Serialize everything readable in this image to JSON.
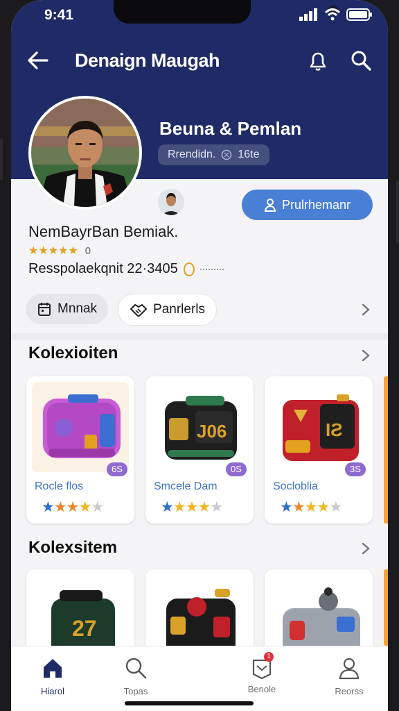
{
  "status_bar": {
    "time": "9:41"
  },
  "header": {
    "title": "Denaign Maugah"
  },
  "profile": {
    "hero_name": "Beuna & Pemlan",
    "hero_tag": "Rrendidn.",
    "hero_tag_count": "16te",
    "follow_label": "Prulrhemanr",
    "name": "NemBayrBan Bemiak.",
    "rating_count": "0",
    "stats_line": "Resspolaekqnit 22·3405",
    "chips": [
      {
        "label": "Mnnak"
      },
      {
        "label": "Panrlerls"
      }
    ]
  },
  "sections": [
    {
      "title": "Kolexioiten",
      "cards": [
        {
          "label": "Rocle flos",
          "badge": "6S",
          "rating": 4
        },
        {
          "label": "Smcele Dam",
          "badge": "0S",
          "rating": 4
        },
        {
          "label": "Socloblia",
          "badge": "3S",
          "rating": 4
        }
      ]
    },
    {
      "title": "Kolexsitem",
      "cards": [
        {
          "label": "",
          "badge": "",
          "rating": 0
        },
        {
          "label": "",
          "badge": "",
          "rating": 0
        },
        {
          "label": "",
          "badge": "",
          "rating": 0
        }
      ]
    }
  ],
  "tabbar": {
    "tabs": [
      {
        "label": "Hiarol",
        "icon": "home-icon",
        "active": true
      },
      {
        "label": "Topas",
        "icon": "search-icon",
        "active": false
      },
      {
        "label": "Benole",
        "icon": "inbox-icon",
        "badge": "1",
        "active": false
      },
      {
        "label": "Reorss",
        "icon": "profile-icon",
        "active": false
      }
    ]
  },
  "colors": {
    "header_bg": "#1f2b66",
    "accent_blue": "#4a7fd6",
    "star_gold": "#f0b51f",
    "star_orange": "#e8862a",
    "star_blue": "#2e6fd1",
    "badge_purple": "#8e6ad1",
    "label_blue": "#3e74c5"
  }
}
